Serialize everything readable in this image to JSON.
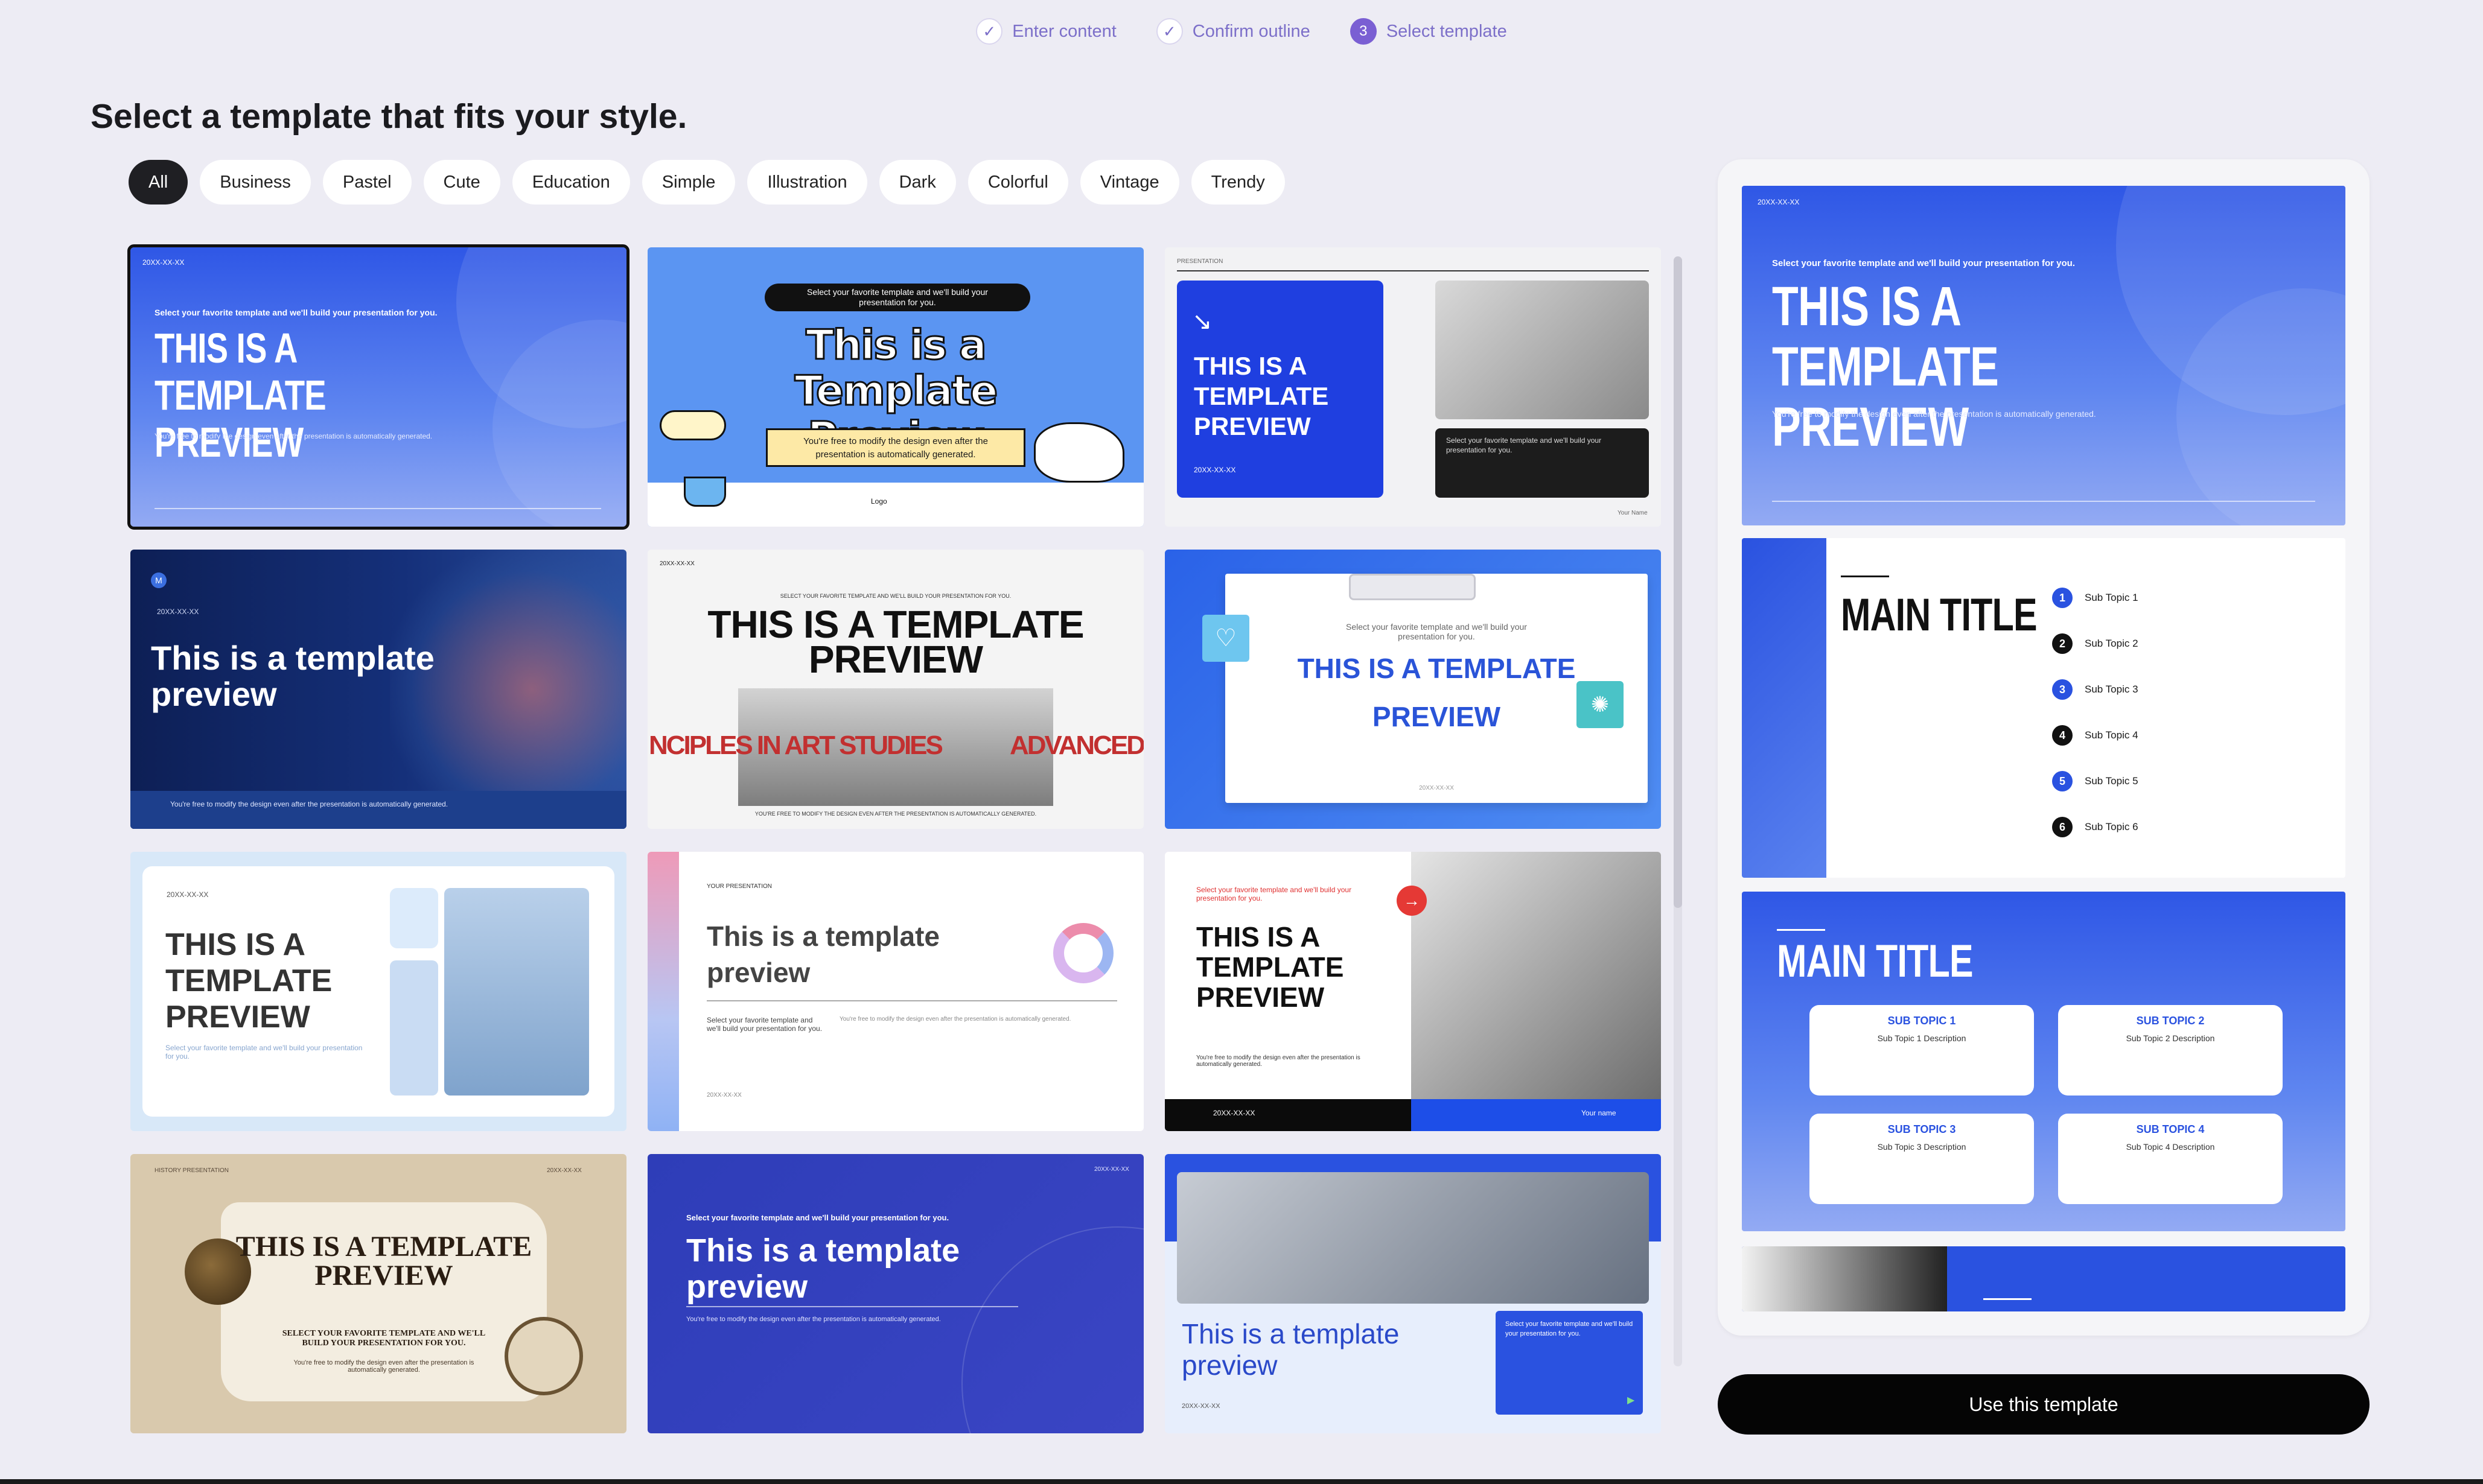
{
  "stepper": {
    "steps": [
      {
        "label": "Enter content",
        "status": "done",
        "icon": "check-icon"
      },
      {
        "label": "Confirm outline",
        "status": "done",
        "icon": "check-icon"
      },
      {
        "label": "Select template",
        "status": "current",
        "number": "3"
      }
    ]
  },
  "heading": "Select a template that fits your style.",
  "filters": [
    "All",
    "Business",
    "Pastel",
    "Cute",
    "Education",
    "Simple",
    "Illustration",
    "Dark",
    "Colorful",
    "Vintage",
    "Trendy"
  ],
  "active_filter": "All",
  "common": {
    "date": "20XX-XX-XX",
    "select_line": "Select your favorite template and we'll build your presentation for you.",
    "free_line": "You're free to modify the design even after the presentation is automatically generated.",
    "your_name": "Your Name",
    "your_name_lower": "Your name"
  },
  "templates": [
    {
      "title": "THIS IS A TEMPLATE PREVIEW"
    },
    {
      "title": "This is a Template Preview",
      "bubble": "Select your favorite template and we'll build your presentation for you.",
      "box": "You're free to modify the design even after the presentation is automatically generated.",
      "logo": "Logo"
    },
    {
      "title": "THIS IS A TEMPLATE PREVIEW",
      "tag": "PRESENTATION",
      "dark_box": "Select your favorite template and we'll build your presentation for you."
    },
    {
      "title": "This is a template preview",
      "badge": "M"
    },
    {
      "title": "THIS IS A TEMPLATE PREVIEW",
      "marquee_left": "NCIPLES IN ART STUDIES",
      "marquee_right": "ADVANCED PRI",
      "top_line": "SELECT YOUR FAVORITE TEMPLATE AND WE'LL BUILD YOUR PRESENTATION FOR YOU.",
      "bottom_line": "YOU'RE FREE TO MODIFY THE DESIGN EVEN AFTER THE PRESENTATION IS AUTOMATICALLY GENERATED."
    },
    {
      "title_a": "THIS IS A TEMPLATE",
      "title_b": "PREVIEW",
      "sub": "Select your favorite template and we'll build your presentation for you."
    },
    {
      "title": "THIS IS A TEMPLATE PREVIEW",
      "sub": "Select your favorite template and we'll build your presentation for you."
    },
    {
      "title": "This is a template preview",
      "tag": "YOUR PRESENTATION",
      "left_text": "Select your favorite template and we'll build your presentation for you."
    },
    {
      "title": "THIS IS A TEMPLATE PREVIEW",
      "red_line": "Select your favorite template and we'll build your presentation for you."
    },
    {
      "title": "THIS IS A TEMPLATE PREVIEW",
      "tag": "HISTORY PRESENTATION",
      "sub": "SELECT YOUR FAVORITE TEMPLATE AND WE'LL BUILD YOUR PRESENTATION FOR YOU."
    },
    {
      "title": "This is a template preview"
    },
    {
      "title": "This is a template preview",
      "box": "Select your favorite template and we'll build your presentation for you."
    }
  ],
  "preview": {
    "cover_title": "THIS IS A TEMPLATE PREVIEW",
    "main_title": "MAIN TITLE",
    "topics": [
      "Sub Topic 1",
      "Sub Topic 2",
      "Sub Topic 3",
      "Sub Topic 4",
      "Sub Topic 5",
      "Sub Topic 6"
    ],
    "cards": [
      {
        "head": "SUB TOPIC 1",
        "desc": "Sub Topic 1 Description"
      },
      {
        "head": "SUB TOPIC 2",
        "desc": "Sub Topic 2 Description"
      },
      {
        "head": "SUB TOPIC 3",
        "desc": "Sub Topic 3 Description"
      },
      {
        "head": "SUB TOPIC 4",
        "desc": "Sub Topic 4 Description"
      }
    ]
  },
  "use_button": "Use this template",
  "colors": {
    "accent": "#7a5fd3",
    "primary_blue": "#2f57e6",
    "dark": "#050505"
  }
}
